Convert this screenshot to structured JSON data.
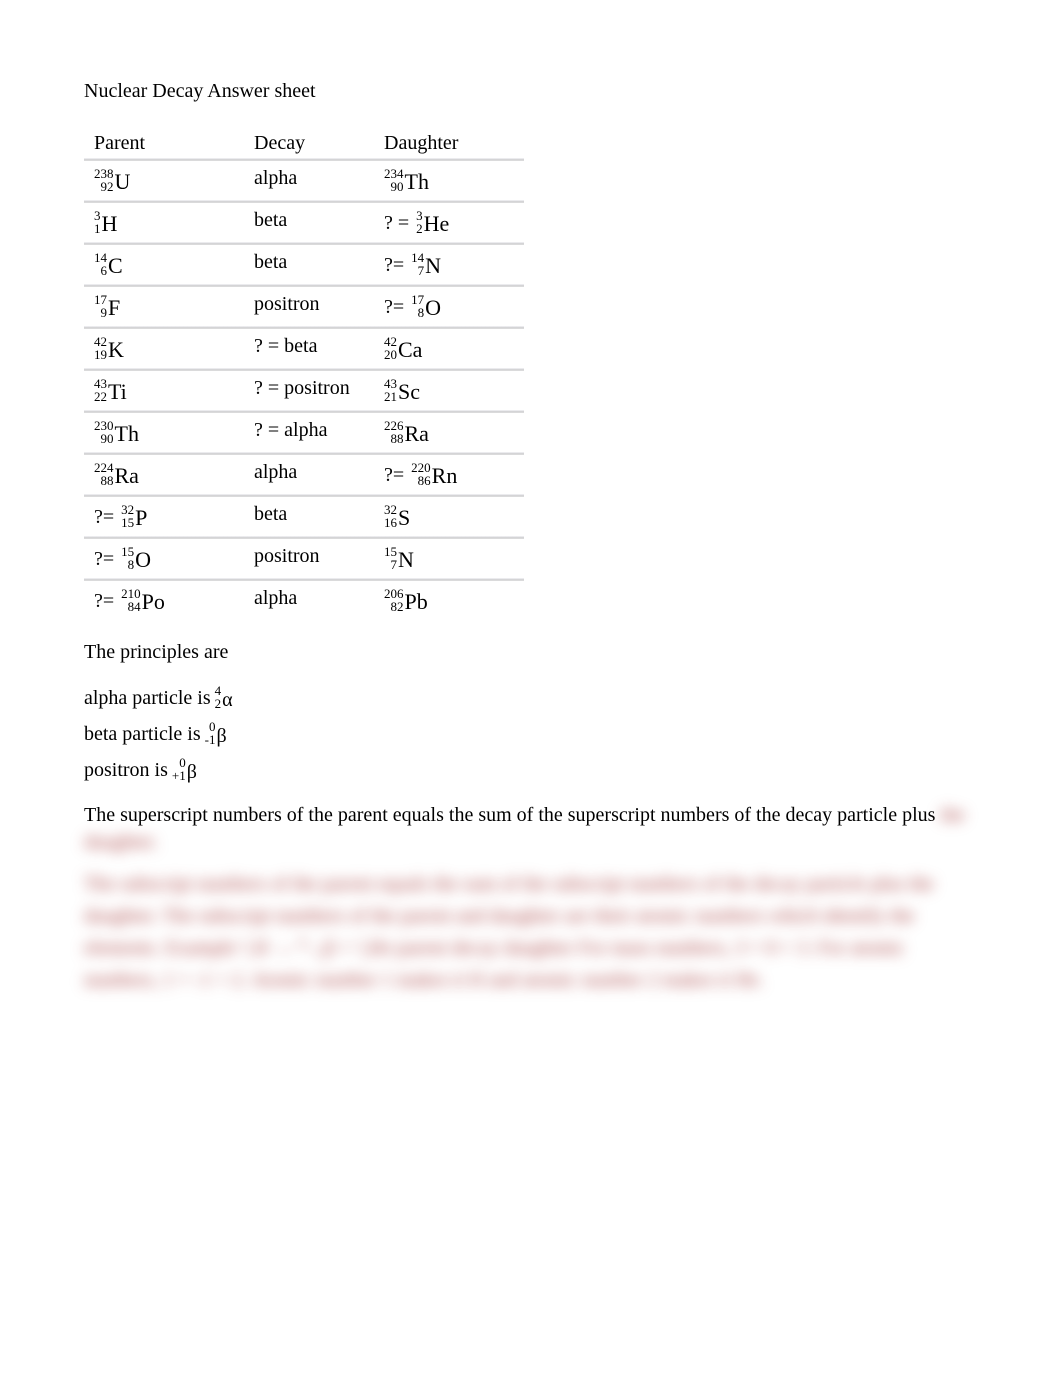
{
  "title": "Nuclear Decay Answer sheet",
  "headers": {
    "parent": "Parent",
    "decay": "Decay",
    "daughter": "Daughter"
  },
  "rows": [
    {
      "parent": {
        "q": "",
        "mass": "238",
        "atomic": "92",
        "sym": "U"
      },
      "decay": "alpha",
      "daughter": {
        "q": "",
        "mass": "234",
        "atomic": "90",
        "sym": "Th"
      }
    },
    {
      "parent": {
        "q": "",
        "mass": "3",
        "atomic": "1",
        "sym": "H"
      },
      "decay": "beta",
      "daughter": {
        "q": "? = ",
        "mass": "3",
        "atomic": "2",
        "sym": "He"
      }
    },
    {
      "parent": {
        "q": "",
        "mass": "14",
        "atomic": "6",
        "sym": "C"
      },
      "decay": "beta",
      "daughter": {
        "q": "?= ",
        "mass": "14",
        "atomic": "7",
        "sym": "N"
      }
    },
    {
      "parent": {
        "q": "",
        "mass": "17",
        "atomic": "9",
        "sym": "F"
      },
      "decay": "positron",
      "daughter": {
        "q": "?= ",
        "mass": "17",
        "atomic": "8",
        "sym": "O"
      }
    },
    {
      "parent": {
        "q": "",
        "mass": "42",
        "atomic": "19",
        "sym": "K"
      },
      "decay": "? = beta",
      "daughter": {
        "q": "",
        "mass": "42",
        "atomic": "20",
        "sym": "Ca"
      }
    },
    {
      "parent": {
        "q": "",
        "mass": "43",
        "atomic": "22",
        "sym": "Ti"
      },
      "decay": "? = positron",
      "daughter": {
        "q": "",
        "mass": "43",
        "atomic": "21",
        "sym": "Sc"
      }
    },
    {
      "parent": {
        "q": "",
        "mass": "230",
        "atomic": "90",
        "sym": "Th"
      },
      "decay": "? = alpha",
      "daughter": {
        "q": "",
        "mass": "226",
        "atomic": "88",
        "sym": "Ra"
      }
    },
    {
      "parent": {
        "q": "",
        "mass": "224",
        "atomic": "88",
        "sym": "Ra"
      },
      "decay": "alpha",
      "daughter": {
        "q": "?= ",
        "mass": "220",
        "atomic": "86",
        "sym": "Rn"
      }
    },
    {
      "parent": {
        "q": "?= ",
        "mass": "32",
        "atomic": "15",
        "sym": "P"
      },
      "decay": "beta",
      "daughter": {
        "q": "",
        "mass": "32",
        "atomic": "16",
        "sym": "S"
      }
    },
    {
      "parent": {
        "q": "?= ",
        "mass": "15",
        "atomic": "8",
        "sym": "O"
      },
      "decay": "positron",
      "daughter": {
        "q": "",
        "mass": "15",
        "atomic": "7",
        "sym": "N"
      }
    },
    {
      "parent": {
        "q": "?= ",
        "mass": "210",
        "atomic": "84",
        "sym": "Po"
      },
      "decay": "alpha",
      "daughter": {
        "q": "",
        "mass": "206",
        "atomic": "82",
        "sym": "Pb"
      }
    }
  ],
  "principles_head": "The principles are",
  "particles": {
    "alpha": {
      "lead": "alpha particle is ",
      "top": "4",
      "bot": "2",
      "sym": "α"
    },
    "beta": {
      "lead": "beta particle is ",
      "top": "0",
      "bot": "-1",
      "sym": "β"
    },
    "positron": {
      "lead": "positron is ",
      "top": "0",
      "bot": "+1",
      "sym": "β"
    }
  },
  "para1": "The superscript numbers of the parent equals the sum of the superscript numbers of the decay particle plus",
  "para1_blur": "the daughter.",
  "blurred": "The subscript numbers of the parent equals the sum of the subscript numbers of the decay particle plus the daughter.\n\nThe subscript numbers of the parent and daughter are their atomic numbers which identify the elements.\n\nExample   ³₁H   →   ⁰₋₁β   +   ³₂He\n                parent      decay       daughter\n\nFor mass numbers, 3 = 0 + 3.   For atomic numbers, 1 = -1 + 2.   Atomic number 1 makes it H and atomic number 2 makes it He."
}
